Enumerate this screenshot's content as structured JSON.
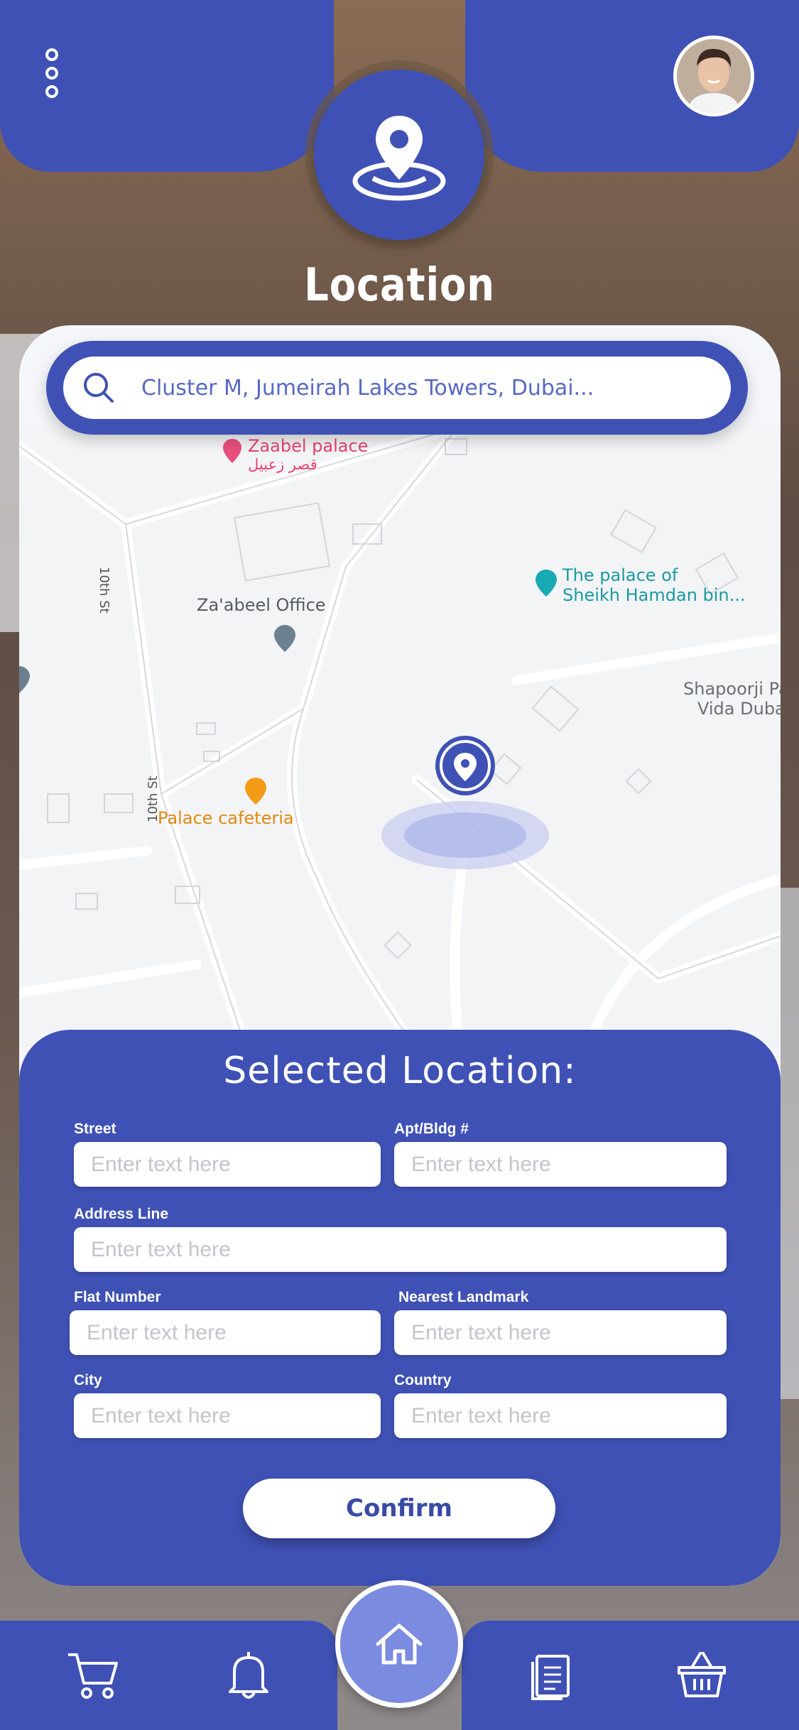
{
  "header": {
    "title": "Location",
    "menu_icon": "more-vertical-icon",
    "avatar": "user-avatar",
    "badge_icon": "location-pin-icon"
  },
  "search": {
    "value": "Cluster M, Jumeirah Lakes Towers, Dubai..."
  },
  "map": {
    "labels": {
      "zaabel_palace": "Zaabel palace",
      "zaabel_palace_ar": "قصر زعبيل",
      "zaabeel_office": "Za'abeel Office",
      "sheikh_palace_line1": "The palace of",
      "sheikh_palace_line2": "Sheikh Hamdan bin...",
      "palace_cafeteria": "Palace cafeteria",
      "shapoorji_line1": "Shapoorji Pa",
      "shapoorji_line2": "Vida Dubai",
      "street_10th_a": "10th St",
      "street_10th_b": "10th St"
    }
  },
  "form": {
    "title": "Selected Location:",
    "fields": {
      "street": {
        "label": "Street",
        "placeholder": "Enter text here"
      },
      "apt": {
        "label": "Apt/Bldg #",
        "placeholder": "Enter text here"
      },
      "address": {
        "label": "Address Line",
        "placeholder": "Enter text here"
      },
      "flat": {
        "label": "Flat Number",
        "placeholder": "Enter text here"
      },
      "landmark": {
        "label": "Nearest Landmark",
        "placeholder": "Enter text here"
      },
      "city": {
        "label": "City",
        "placeholder": "Enter text here"
      },
      "country": {
        "label": "Country",
        "placeholder": "Enter text here"
      }
    },
    "confirm_label": "Confirm"
  },
  "nav": {
    "items": [
      "cart-icon",
      "bell-icon",
      "home-icon",
      "document-icon",
      "basket-icon"
    ]
  },
  "colors": {
    "primary": "#3f51b5",
    "primary_light": "#7b8be0",
    "white": "#ffffff"
  }
}
